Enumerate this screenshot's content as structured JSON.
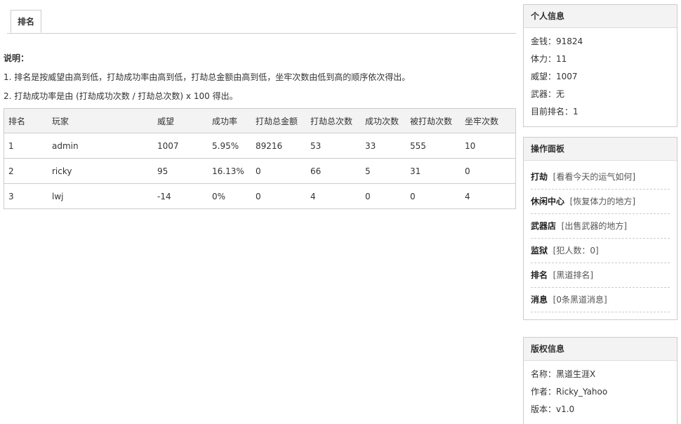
{
  "tab": {
    "label": "排名"
  },
  "note": {
    "heading": "说明：",
    "lines": [
      "1. 排名是按威望由高到低，打劫成功率由高到低，打劫总金额由高到低，坐牢次数由低到高的顺序依次得出。",
      "2. 打劫成功率是由 (打劫成功次数 / 打劫总次数) x 100 得出。"
    ]
  },
  "table": {
    "headers": [
      "排名",
      "玩家",
      "威望",
      "成功率",
      "打劫总金额",
      "打劫总次数",
      "成功次数",
      "被打劫次数",
      "坐牢次数"
    ],
    "rows": [
      [
        "1",
        "admin",
        "1007",
        "5.95%",
        "89216",
        "53",
        "33",
        "555",
        "10"
      ],
      [
        "2",
        "ricky",
        "95",
        "16.13%",
        "0",
        "66",
        "5",
        "31",
        "0"
      ],
      [
        "3",
        "lwj",
        "-14",
        "0%",
        "0",
        "4",
        "0",
        "0",
        "4"
      ]
    ]
  },
  "personal": {
    "title": "个人信息",
    "lines": [
      "金钱：91824",
      "体力：11",
      "威望：1007",
      "武器：无",
      "目前排名：1"
    ]
  },
  "ops": {
    "title": "操作面板",
    "items": [
      {
        "name": "打劫",
        "desc": "[看看今天的运气如何]"
      },
      {
        "name": "休闲中心",
        "desc": "[恢复体力的地方]"
      },
      {
        "name": "武器店",
        "desc": "[出售武器的地方]"
      },
      {
        "name": "监狱",
        "desc": "[犯人数：0]"
      },
      {
        "name": "排名",
        "desc": "[黑道排名]"
      },
      {
        "name": "消息",
        "desc": "[0条黑道消息]"
      }
    ]
  },
  "copyright": {
    "title": "版权信息",
    "lines": [
      "名称：黑道生涯X",
      "作者：Ricky_Yahoo",
      "版本：v1.0"
    ]
  }
}
